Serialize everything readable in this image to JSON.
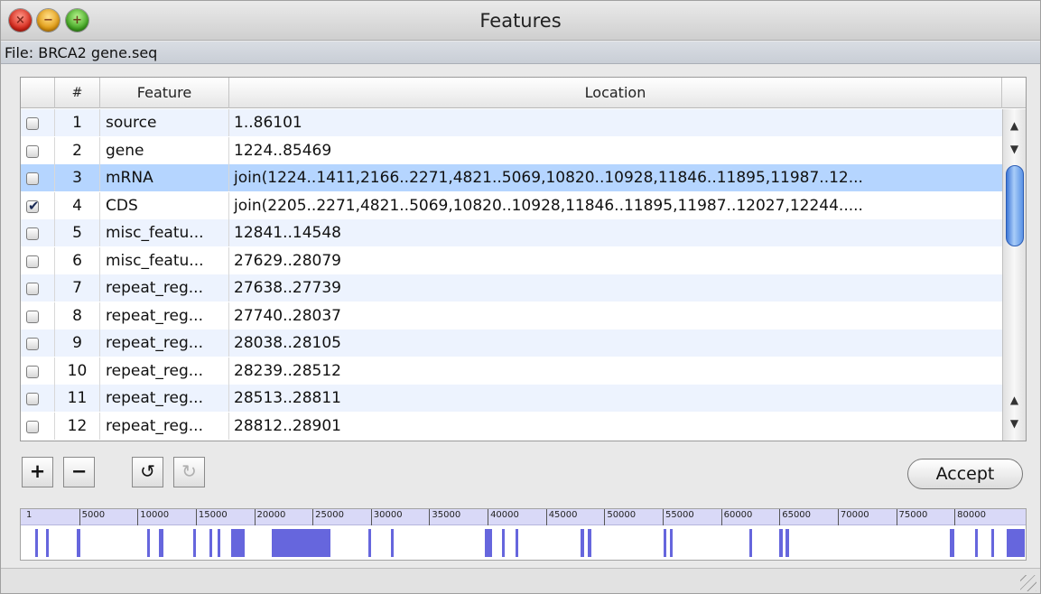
{
  "window": {
    "title": "Features",
    "file_label": "File: BRCA2 gene.seq"
  },
  "table": {
    "columns": [
      "#",
      "Feature",
      "Location"
    ],
    "rows": [
      {
        "checked": false,
        "num": "1",
        "feature": "source",
        "location": "1..86101"
      },
      {
        "checked": false,
        "num": "2",
        "feature": "gene",
        "location": "1224..85469"
      },
      {
        "checked": false,
        "num": "3",
        "feature": "mRNA",
        "location": "join(1224..1411,2166..2271,4821..5069,10820..10928,11846..11895,11987..12...",
        "selected": true
      },
      {
        "checked": true,
        "num": "4",
        "feature": "CDS",
        "location": "join(2205..2271,4821..5069,10820..10928,11846..11895,11987..12027,12244....."
      },
      {
        "checked": false,
        "num": "5",
        "feature": "misc_featu...",
        "location": "12841..14548"
      },
      {
        "checked": false,
        "num": "6",
        "feature": "misc_featu...",
        "location": "27629..28079"
      },
      {
        "checked": false,
        "num": "7",
        "feature": "repeat_reg...",
        "location": "27638..27739"
      },
      {
        "checked": false,
        "num": "8",
        "feature": "repeat_reg...",
        "location": "27740..28037"
      },
      {
        "checked": false,
        "num": "9",
        "feature": "repeat_reg...",
        "location": "28038..28105"
      },
      {
        "checked": false,
        "num": "10",
        "feature": "repeat_reg...",
        "location": "28239..28512"
      },
      {
        "checked": false,
        "num": "11",
        "feature": "repeat_reg...",
        "location": "28513..28811"
      },
      {
        "checked": false,
        "num": "12",
        "feature": "repeat_reg...",
        "location": "28812..28901"
      }
    ]
  },
  "toolbar": {
    "add_label": "+",
    "remove_label": "−",
    "undo_label": "↺",
    "redo_label": "↻",
    "accept_label": "Accept"
  },
  "feature_map": {
    "length": 86101,
    "ruler_labels": [
      "1",
      "5000",
      "10000",
      "15000",
      "20000",
      "25000",
      "30000",
      "35000",
      "40000",
      "45000",
      "50000",
      "55000",
      "60000",
      "65000",
      "70000",
      "75000",
      "80000"
    ],
    "ruler_positions": [
      1,
      5000,
      10000,
      15000,
      20000,
      25000,
      30000,
      35000,
      40000,
      45000,
      50000,
      55000,
      60000,
      65000,
      70000,
      75000,
      80000
    ],
    "bar_color": "#6666dd",
    "segments": [
      [
        1224,
        1411
      ],
      [
        2166,
        2271
      ],
      [
        4821,
        5069
      ],
      [
        10820,
        10928
      ],
      [
        11846,
        11895
      ],
      [
        11987,
        12027
      ],
      [
        14800,
        14950
      ],
      [
        16200,
        16300
      ],
      [
        16900,
        17000
      ],
      [
        18000,
        19200
      ],
      [
        21500,
        26500
      ],
      [
        29800,
        29900
      ],
      [
        31700,
        31800
      ],
      [
        39800,
        40400
      ],
      [
        41200,
        41300
      ],
      [
        42400,
        42500
      ],
      [
        48000,
        48300
      ],
      [
        48600,
        48900
      ],
      [
        55100,
        55200
      ],
      [
        55600,
        55700
      ],
      [
        62400,
        62500
      ],
      [
        65000,
        65300
      ],
      [
        65500,
        65800
      ],
      [
        79600,
        80000
      ],
      [
        81800,
        81900
      ],
      [
        83200,
        83300
      ],
      [
        84500,
        86000
      ]
    ]
  }
}
